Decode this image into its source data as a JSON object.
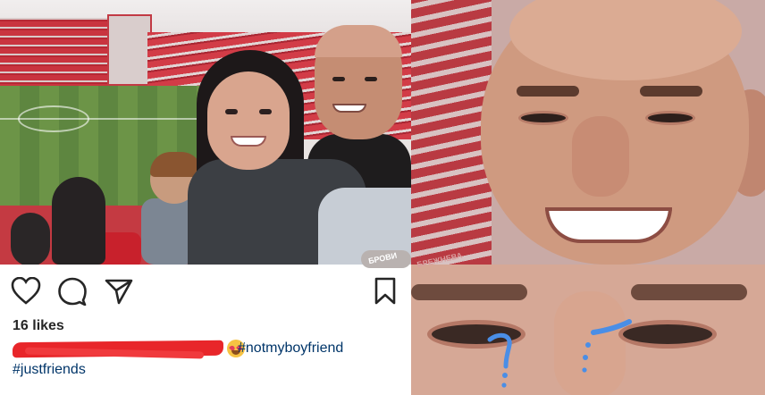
{
  "post": {
    "likes": "16 likes",
    "hashtags": [
      "#notmyboyfriend",
      "#justfriends"
    ]
  },
  "icons": {
    "like": "heart-icon",
    "comment": "comment-icon",
    "share": "paper-plane-icon",
    "save": "bookmark-icon"
  },
  "watermark": {
    "left": "БРОВИ",
    "right": "БРЕЖНЕВА"
  },
  "colors": {
    "hashtag": "#003569",
    "redaction": "#e8262a",
    "tears": "#4a8ee6"
  }
}
